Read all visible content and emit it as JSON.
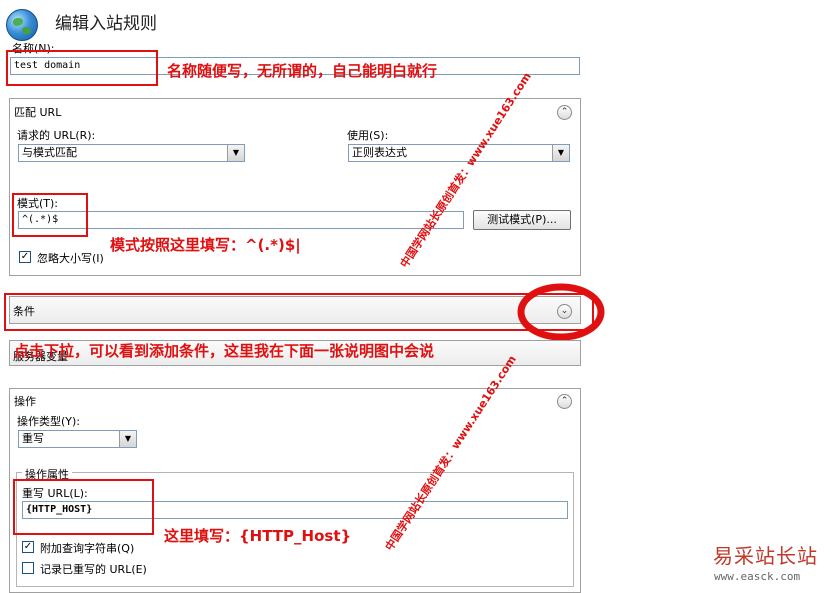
{
  "dialog": {
    "title": "编辑入站规则",
    "name_label": "名称(N):",
    "name_value": "test domain"
  },
  "match_url": {
    "header": "匹配 URL",
    "requested_url_label": "请求的 URL(R):",
    "requested_url_value": "与模式匹配",
    "using_label": "使用(S):",
    "using_value": "正则表达式",
    "pattern_label": "模式(T):",
    "pattern_value": "^(.*)$",
    "test_pattern_button": "测试模式(P)...",
    "ignore_case_label": "忽略大小写(I)",
    "ignore_case_checked": true,
    "collapse_glyph": "⌃"
  },
  "conditions": {
    "header": "条件",
    "expand_glyph": "⌄"
  },
  "server_variables": {
    "header": "服务器变量"
  },
  "action": {
    "header": "操作",
    "collapse_glyph": "⌃",
    "type_label": "操作类型(Y):",
    "type_value": "重写",
    "properties_legend": "操作属性",
    "rewrite_url_label": "重写 URL(L):",
    "rewrite_url_value": "{HTTP_HOST}",
    "append_query_label": "附加查询字符串(Q)",
    "append_query_checked": true,
    "log_rewritten_label": "记录已重写的 URL(E)",
    "log_rewritten_checked": false
  },
  "annotations": {
    "name_note": "名称随便写，无所谓的，自己能明白就行",
    "pattern_note": "模式按照这里填写：^(.*)$|",
    "conditions_note": "点击下拉，可以看到添加条件，这里我在下面一张说明图中会说",
    "rewrite_note": "这里填写：{HTTP_Host}",
    "watermark_1": "中国学网站长原创首发：www.xue163.com",
    "watermark_2": "中国学网站长原创首发：www.xue163.com"
  },
  "brand": {
    "name": "易采站长站",
    "url": "www.easck.com"
  },
  "icons": {
    "app_icon": "globe-icon",
    "dropdown": "chevron-down-icon",
    "collapse": "chevron-up-icon",
    "expand": "chevron-down-icon",
    "check": "check-icon"
  },
  "colors": {
    "annotation_red": "#e01010",
    "border_blue": "#7f9db9"
  }
}
